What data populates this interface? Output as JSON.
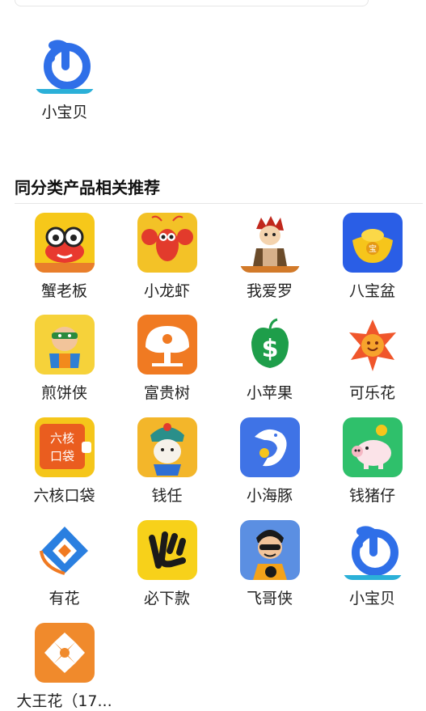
{
  "featured_app": {
    "name": "小宝贝",
    "icon": "xiaobaobei-icon"
  },
  "section": {
    "title": "同分类产品相关推荐"
  },
  "related_apps": [
    {
      "name": "蟹老板",
      "icon": "crab-icon"
    },
    {
      "name": "小龙虾",
      "icon": "lobster-icon"
    },
    {
      "name": "我爱罗",
      "icon": "gaara-icon"
    },
    {
      "name": "八宝盆",
      "icon": "gold-ingot-icon"
    },
    {
      "name": "煎饼侠",
      "icon": "jianbingxia-icon"
    },
    {
      "name": "富贵树",
      "icon": "tree-icon"
    },
    {
      "name": "小苹果",
      "icon": "apple-dollar-icon"
    },
    {
      "name": "可乐花",
      "icon": "smiling-flower-icon"
    },
    {
      "name": "六核口袋",
      "icon": "liuhe-pocket-icon"
    },
    {
      "name": "钱任",
      "icon": "opera-mask-icon"
    },
    {
      "name": "小海豚",
      "icon": "dolphin-icon"
    },
    {
      "name": "钱猪仔",
      "icon": "piggy-bank-icon"
    },
    {
      "name": "有花",
      "icon": "youhua-icon"
    },
    {
      "name": "必下款",
      "icon": "bixiakuan-icon"
    },
    {
      "name": "飞哥侠",
      "icon": "feigexia-icon"
    },
    {
      "name": "小宝贝",
      "icon": "xiaobaobei-icon"
    },
    {
      "name": "大王花（17...",
      "icon": "dawanghua-icon"
    }
  ]
}
